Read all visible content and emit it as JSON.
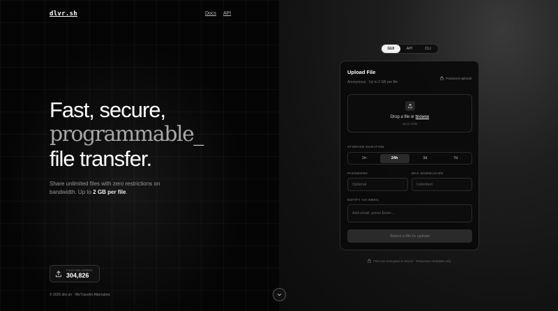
{
  "header": {
    "logo": "dlvr.sh",
    "nav": [
      "Docs",
      "API"
    ]
  },
  "hero": {
    "line1": "Fast, secure,",
    "line2": "programmable",
    "cursor": "_",
    "line3": "file transfer.",
    "sub_text": "Share unlimited files with zero restrictions on bandwidth. Up to ",
    "sub_bold": "2 GB per file",
    "sub_end": "."
  },
  "counter": {
    "label": "Files Delivered",
    "value": "304,826",
    "icon": "upload-icon"
  },
  "footer": {
    "text": "© 2026 dlvr.sh · WeTransfer Alternative"
  },
  "modes": {
    "items": [
      "GUI",
      "API",
      "CLI"
    ],
    "active": "GUI"
  },
  "card": {
    "title": "Upload File",
    "desc": "Anonymous · Up to 2 GB per file",
    "password_optional": "Password optional",
    "drop": {
      "prefix": "Drop a file or ",
      "link": "browse",
      "limit": "Up to 2GB"
    },
    "storage": {
      "label": "Storage Duration",
      "options": [
        "1h",
        "24h",
        "3d",
        "7d"
      ],
      "active": "24h"
    },
    "password": {
      "label": "Password",
      "placeholder": "Optional"
    },
    "max_downloads": {
      "label": "Max Downloads",
      "placeholder": "Unlimited"
    },
    "notify": {
      "label": "Notify via Email",
      "placeholder": "Add email, press Enter..."
    },
    "submit_label": "Select a file to upload"
  },
  "note": "Files are encrypted in transit · Temporary metadata only",
  "colors": {
    "background": "#000000",
    "accent": "#f2f2f2",
    "muted": "#888888"
  }
}
